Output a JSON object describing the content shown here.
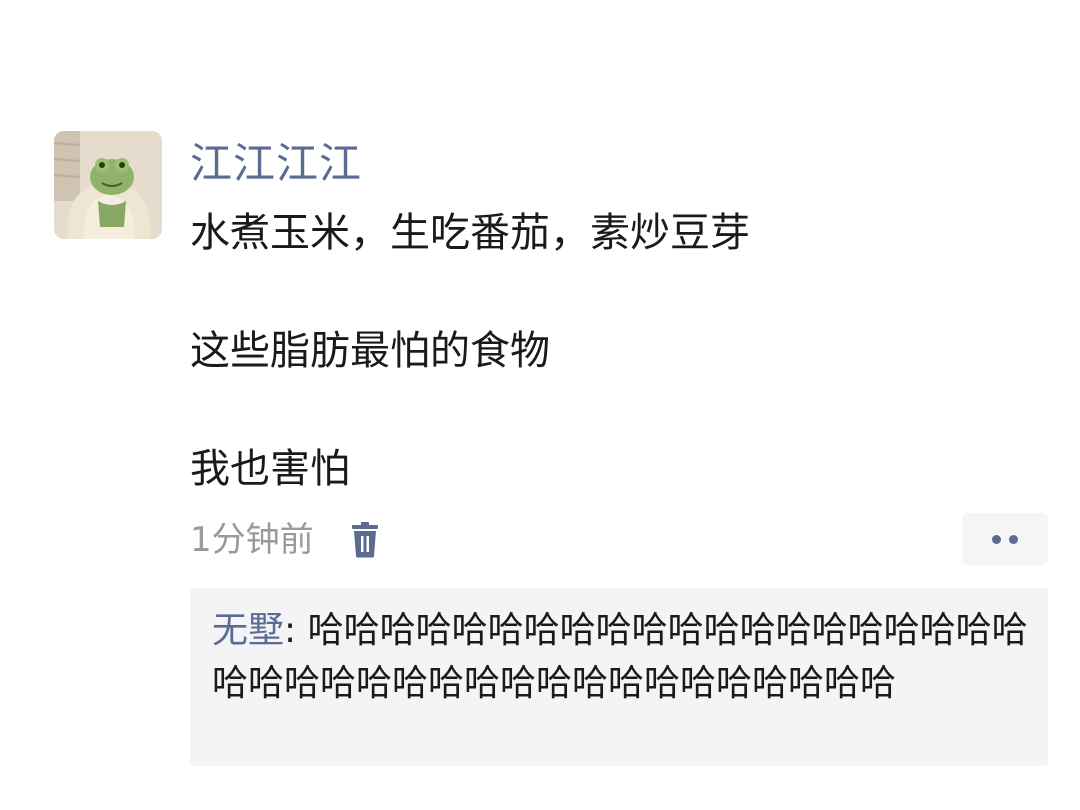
{
  "comment": {
    "username": "江江江江",
    "lines": [
      "水煮玉米，生吃番茄，素炒豆芽",
      "这些脂肪最怕的食物",
      "我也害怕"
    ],
    "time": "1分钟前"
  },
  "reply": {
    "author": "无墅",
    "separator": ": ",
    "text": "哈哈哈哈哈哈哈哈哈哈哈哈哈哈哈哈哈哈哈哈哈哈哈哈哈哈哈哈哈哈哈哈哈哈哈哈哈哈哈"
  },
  "icons": {
    "delete": "trash-icon",
    "more": "more-dots-icon",
    "avatar": "frog-avatar"
  },
  "colors": {
    "name_blue": "#5b6b92",
    "time_gray": "#9a9a9a",
    "reply_bg": "#f4f4f6"
  }
}
